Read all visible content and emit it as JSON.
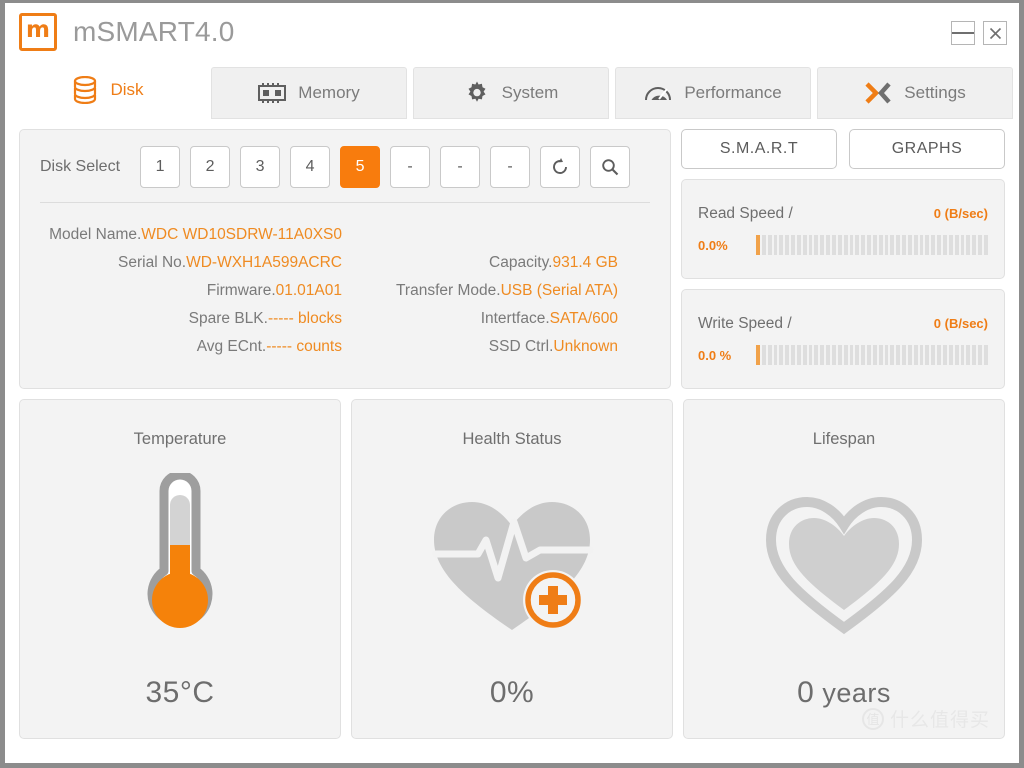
{
  "window": {
    "app_title": "mSMART4.0",
    "logo_glyph": "m",
    "minimize_label": "–",
    "close_label": "✕"
  },
  "tabs": [
    {
      "label": "Disk",
      "icon": "database-icon",
      "active": true
    },
    {
      "label": "Memory",
      "icon": "memory-chip-icon",
      "active": false
    },
    {
      "label": "System",
      "icon": "gear-icon",
      "active": false
    },
    {
      "label": "Performance",
      "icon": "gauge-icon",
      "active": false
    },
    {
      "label": "Settings",
      "icon": "chevrons-x-icon",
      "active": false
    }
  ],
  "disk_select": {
    "label": "Disk Select",
    "buttons": [
      "1",
      "2",
      "3",
      "4",
      "5",
      "-",
      "-",
      "-"
    ],
    "selected": "5",
    "refresh_icon": "refresh-icon",
    "search_icon": "search-icon"
  },
  "disk_info": {
    "left": [
      {
        "key": "Model Name.",
        "value": "WDC WD10SDRW-11A0XS0"
      },
      {
        "key": "Serial No.",
        "value": "WD-WXH1A599ACRC"
      },
      {
        "key": "Firmware.",
        "value": "01.01A01"
      },
      {
        "key": "Spare BLK.",
        "value": "----- blocks"
      },
      {
        "key": "Avg ECnt.",
        "value": "----- counts"
      }
    ],
    "right": [
      {
        "key": "Capacity.",
        "value": "931.4 GB"
      },
      {
        "key": "Transfer Mode.",
        "value": "USB (Serial ATA)"
      },
      {
        "key": "Intertface.",
        "value": "SATA/600"
      },
      {
        "key": "SSD Ctrl.",
        "value": "Unknown"
      }
    ]
  },
  "actions": {
    "smart_label": "S.M.A.R.T",
    "graphs_label": "GRAPHS"
  },
  "speeds": [
    {
      "title": "Read Speed /",
      "value": "0 (B/sec)",
      "percent": "0.0%",
      "fill_segments": 1
    },
    {
      "title": "Write Speed /",
      "value": "0 (B/sec)",
      "percent": "0.0 %",
      "fill_segments": 1
    }
  ],
  "cards": [
    {
      "title": "Temperature",
      "value": "35°C",
      "unit": "",
      "icon": "thermometer-icon"
    },
    {
      "title": "Health Status",
      "value": "0%",
      "unit": "",
      "icon": "heart-pulse-icon"
    },
    {
      "title": "Lifespan",
      "value": "0",
      "unit": "years",
      "icon": "heart-outline-icon"
    }
  ],
  "watermark": {
    "badge": "值",
    "text": "什么值得买"
  },
  "colors": {
    "accent": "#ef7d16",
    "accent_strong": "#f87c0d",
    "text_grey": "#6f6f6f",
    "panel_bg": "#f3f3f3"
  }
}
